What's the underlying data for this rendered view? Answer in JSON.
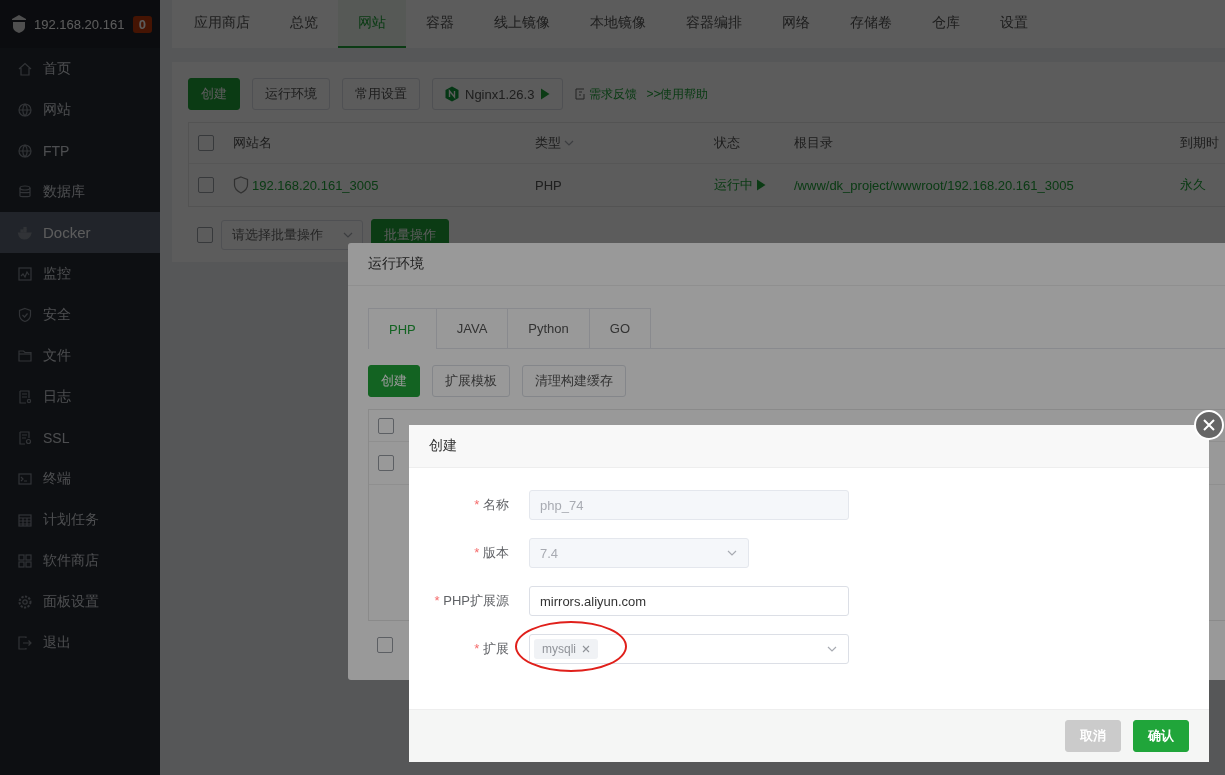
{
  "sidebar": {
    "host": "192.168.20.161",
    "badge": "0",
    "items": [
      {
        "label": "首页",
        "selected": false
      },
      {
        "label": "网站",
        "selected": false
      },
      {
        "label": "FTP",
        "selected": false
      },
      {
        "label": "数据库",
        "selected": false
      },
      {
        "label": "Docker",
        "selected": true
      },
      {
        "label": "监控",
        "selected": false
      },
      {
        "label": "安全",
        "selected": false
      },
      {
        "label": "文件",
        "selected": false
      },
      {
        "label": "日志",
        "selected": false
      },
      {
        "label": "SSL",
        "selected": false
      },
      {
        "label": "终端",
        "selected": false
      },
      {
        "label": "计划任务",
        "selected": false
      },
      {
        "label": "软件商店",
        "selected": false
      },
      {
        "label": "面板设置",
        "selected": false
      },
      {
        "label": "退出",
        "selected": false
      }
    ]
  },
  "nav_tabs": [
    {
      "label": "应用商店",
      "selected": false
    },
    {
      "label": "总览",
      "selected": false
    },
    {
      "label": "网站",
      "selected": true
    },
    {
      "label": "容器",
      "selected": false
    },
    {
      "label": "线上镜像",
      "selected": false
    },
    {
      "label": "本地镜像",
      "selected": false
    },
    {
      "label": "容器编排",
      "selected": false
    },
    {
      "label": "网络",
      "selected": false
    },
    {
      "label": "存储卷",
      "selected": false
    },
    {
      "label": "仓库",
      "selected": false
    },
    {
      "label": "设置",
      "selected": false
    }
  ],
  "toolbar": {
    "buttons": [
      {
        "label": "创建",
        "kind": "primary"
      },
      {
        "label": "运行环境",
        "kind": "default"
      },
      {
        "label": "常用设置",
        "kind": "default"
      },
      {
        "label": "Nginx1.26.3",
        "kind": "server"
      }
    ],
    "links": [
      {
        "label": "需求反馈",
        "kind": "feedback"
      },
      {
        "label": ">>使用帮助",
        "kind": "help"
      }
    ]
  },
  "table": {
    "header_checked": false,
    "columns": [
      "网站名",
      "类型",
      "状态",
      "根目录",
      "到期时"
    ],
    "rows": [
      {
        "checked": false,
        "name": "192.168.20.161_3005",
        "type": "PHP",
        "status": "运行中",
        "root": "/www/dk_project/wwwroot/192.168.20.161_3005",
        "expiry": "永久"
      }
    ]
  },
  "batch": {
    "checked": false,
    "placeholder": "请选择批量操作",
    "button": "批量操作"
  },
  "runtime_dialog": {
    "title": "运行环境",
    "tabs": [
      {
        "label": "PHP",
        "selected": true
      },
      {
        "label": "JAVA",
        "selected": false
      },
      {
        "label": "Python",
        "selected": false
      },
      {
        "label": "GO",
        "selected": false
      }
    ],
    "buttons": [
      {
        "label": "创建",
        "kind": "primary"
      },
      {
        "label": "扩展模板",
        "kind": "default"
      },
      {
        "label": "清理构建缓存",
        "kind": "default"
      }
    ],
    "rows_checked": [
      {
        "checked": false
      },
      {
        "checked": false
      }
    ],
    "footer_checked": false
  },
  "create_dialog": {
    "title": "创建",
    "fields": [
      {
        "label": "名称",
        "required_mark": "*",
        "kind": "input",
        "value": "php_74",
        "disabled": true
      },
      {
        "label": "版本",
        "required_mark": "*",
        "kind": "select",
        "value": "7.4",
        "disabled": true
      },
      {
        "label": "PHP扩展源",
        "required_mark": "*",
        "kind": "input",
        "value": "mirrors.aliyun.com",
        "disabled": false
      },
      {
        "label": "扩展",
        "required_mark": "*",
        "kind": "tags",
        "disabled": false,
        "tags": [
          {
            "label": "mysqli",
            "highlighted": true
          }
        ]
      }
    ],
    "buttons": [
      {
        "label": "取消",
        "kind": "cancel"
      },
      {
        "label": "确认",
        "kind": "primary"
      }
    ]
  }
}
